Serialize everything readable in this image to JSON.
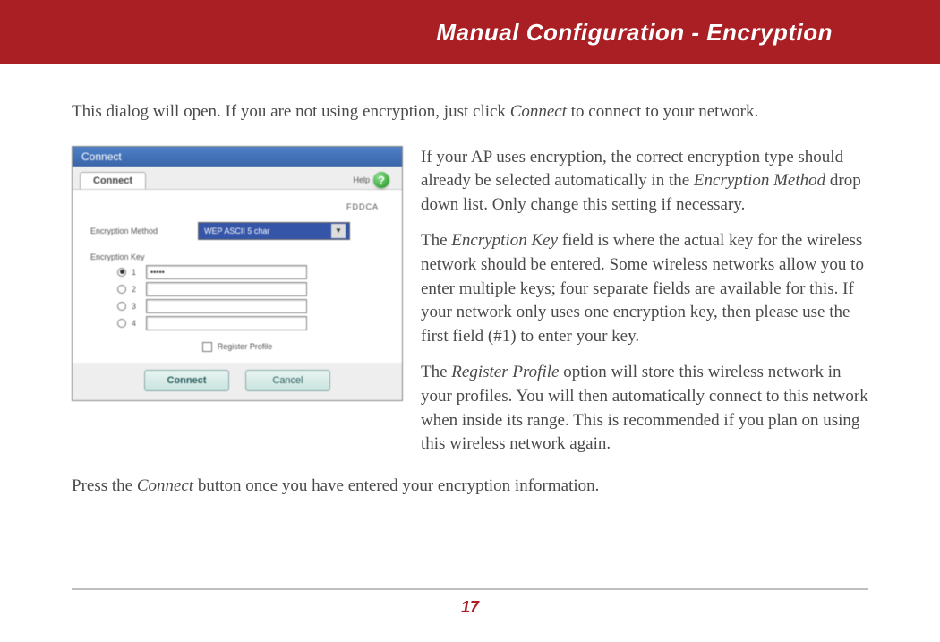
{
  "header": {
    "title": "Manual Configuration - Encryption"
  },
  "intro": {
    "pre": "This dialog will open.  If you are not using encryption, just click ",
    "connect": "Connect",
    "post": " to connect to your network."
  },
  "dialog": {
    "title": "Connect",
    "tab": "Connect",
    "help_label": "Help",
    "ssid": "FDDCA",
    "method_label": "Encryption Method",
    "method_value": "WEP ASCII 5 char",
    "key_label": "Encryption Key",
    "keys": [
      {
        "idx": "1",
        "checked": true,
        "value": "•••••"
      },
      {
        "idx": "2",
        "checked": false,
        "value": ""
      },
      {
        "idx": "3",
        "checked": false,
        "value": ""
      },
      {
        "idx": "4",
        "checked": false,
        "value": ""
      }
    ],
    "register_label": "Register Profile",
    "connect_btn": "Connect",
    "cancel_btn": "Cancel"
  },
  "side": {
    "p1a": "If your AP uses encryption, the correct encryption type should already be selected automatically in the ",
    "p1i": "Encryption Method",
    "p1b": " drop down list.  Only change this setting if necessary.",
    "p2a": "The ",
    "p2i": "Encryption Key",
    "p2b": " field is where the actual key for the wireless network should be entered.  Some wireless networks allow you to enter multiple keys; four separate fields are available for this.  If your network only uses one encryption key, then please use the first field (#1) to enter your key.",
    "p3a": "The ",
    "p3i": "Register Profile",
    "p3b": " option will store this wireless network in your profiles.  You will then automatically connect to this network when inside its range.  This is recommended if you plan on using this wireless network again."
  },
  "after": {
    "pre": "Press the ",
    "connect": "Connect",
    "post": " button once you have entered your encryption information."
  },
  "page_number": "17"
}
